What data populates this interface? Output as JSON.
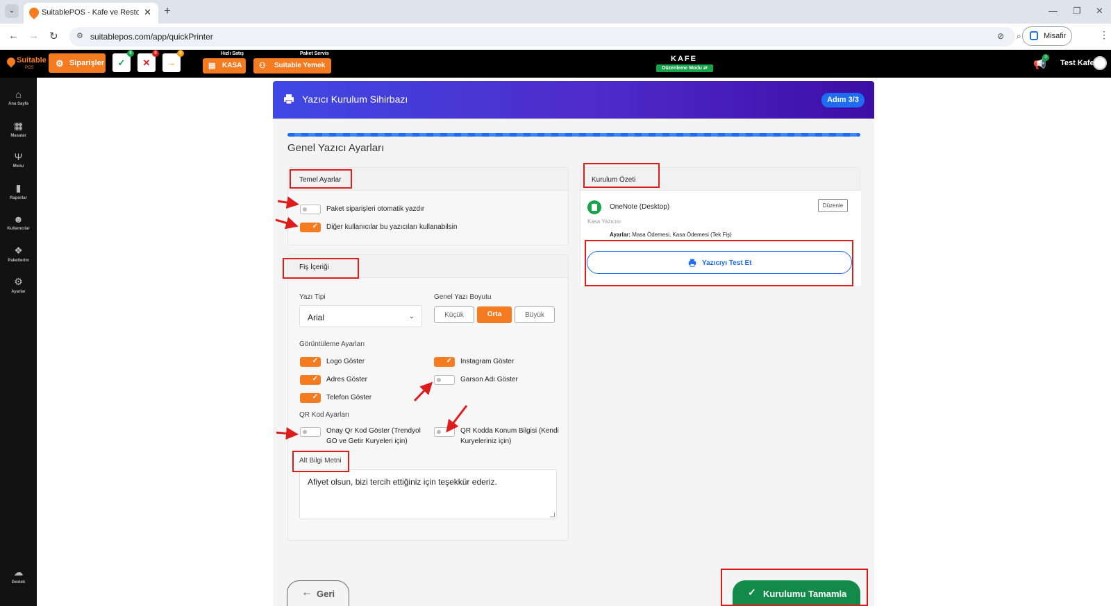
{
  "browser": {
    "tab_title": "SuitablePOS - Kafe ve Restoran",
    "url": "suitablepos.com/app/quickPrinter",
    "profile_label": "Misafir"
  },
  "topbar": {
    "logo_text": "Suitable",
    "logo_sub": "POS",
    "orders_label": "Siparişler",
    "badge_approved": "0",
    "badge_cancelled": "0",
    "badge_forwarded": "0",
    "quick_sale_tag": "Hızlı Satış",
    "kasa_label": "KASA",
    "package_tag": "Paket Servis",
    "suitable_yemek_label": "Suitable Yemek",
    "venue_name": "KAFE",
    "edit_mode_label": "Düzenleme Modu",
    "announce_badge": "0",
    "user_name": "Test Kafe"
  },
  "sidebar": {
    "items": [
      {
        "label": "Ana Sayfa",
        "icon": "home-icon"
      },
      {
        "label": "Masalar",
        "icon": "tables-icon"
      },
      {
        "label": "Menu",
        "icon": "utensils-icon"
      },
      {
        "label": "Raporlar",
        "icon": "report-icon"
      },
      {
        "label": "Kullanıcılar",
        "icon": "users-icon"
      },
      {
        "label": "Paketlerim",
        "icon": "gift-icon"
      },
      {
        "label": "Ayarlar",
        "icon": "gear-icon"
      }
    ],
    "support_label": "Destek"
  },
  "wizard": {
    "title": "Yazıcı Kurulum Sihirbazı",
    "step": "Adım 3/3",
    "progress": 1.0,
    "section_title": "Genel Yazıcı Ayarları",
    "basic_settings": {
      "title": "Temel Ayarlar",
      "toggles": [
        {
          "label": "Paket siparişleri otomatik yazdır",
          "checked": false
        },
        {
          "label": "Diğer kullanıcılar bu yazıcıları kullanabilsin",
          "checked": true
        }
      ]
    },
    "receipt": {
      "title": "Fiş İçeriği",
      "font_label": "Yazı Tipi",
      "font_value": "Arial",
      "size_label": "Genel Yazı Boyutu",
      "sizes": [
        "Küçük",
        "Orta",
        "Büyük"
      ],
      "size_selected": "Orta",
      "display_label": "Görüntüleme Ayarları",
      "display_toggles": [
        {
          "label": "Logo Göster",
          "checked": true
        },
        {
          "label": "Instagram Göster",
          "checked": true
        },
        {
          "label": "Adres Göster",
          "checked": true
        },
        {
          "label": "Garson Adı Göster",
          "checked": false
        },
        {
          "label": "Telefon Göster",
          "checked": true
        }
      ],
      "qr_label": "QR Kod Ayarları",
      "qr_toggles": [
        {
          "label": "Onay Qr Kod Göster (Trendyol GO ve Getir Kuryeleri için)",
          "checked": false
        },
        {
          "label": "QR Kodda Konum Bilgisi (Kendi Kuryeleriniz için)",
          "checked": false
        }
      ],
      "footer_label": "Alt Bilgi Metni",
      "footer_text": "Afiyet olsun, bizi tercih ettiğiniz için teşekkür ederiz."
    },
    "summary": {
      "title": "Kurulum Özeti",
      "printer_name": "OneNote (Desktop)",
      "printer_role": "Kasa Yazıcısı",
      "settings_prefix": "Ayarlar:",
      "settings_value": "Masa Ödemesi, Kasa Ödemesi (Tek Fiş)",
      "edit_label": "Düzenle",
      "test_label": "Yazıcıyı Test Et"
    },
    "back_label": "Geri",
    "finish_label": "Kurulumu Tamamla"
  },
  "colors": {
    "accent": "#f47b20",
    "primary": "#1d6cf2",
    "success": "#118a4a",
    "annotation": "#dd1c1c"
  }
}
